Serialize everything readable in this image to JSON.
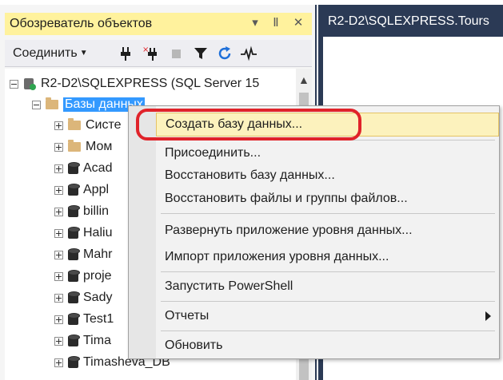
{
  "explorer": {
    "title": "Обозреватель объектов",
    "title_buttons": {
      "dropdown": "▾",
      "pin": "Ⅱ",
      "close": "✕"
    },
    "toolbar": {
      "connect_label": "Соединить"
    }
  },
  "tree": {
    "server": "R2-D2\\SQLEXPRESS (SQL Server 15",
    "databases_folder": "Базы данных",
    "items": [
      {
        "label": "Систе",
        "kind": "folder"
      },
      {
        "label": "Мом",
        "kind": "folder"
      },
      {
        "label": "Acad",
        "kind": "db"
      },
      {
        "label": "Appl",
        "kind": "db"
      },
      {
        "label": "billin",
        "kind": "db"
      },
      {
        "label": "Haliu",
        "kind": "db"
      },
      {
        "label": "Mahr",
        "kind": "db"
      },
      {
        "label": "proje",
        "kind": "db"
      },
      {
        "label": "Sady",
        "kind": "db"
      },
      {
        "label": "Test1",
        "kind": "db"
      },
      {
        "label": "Tima",
        "kind": "db"
      },
      {
        "label": "Timasheva_DB",
        "kind": "db"
      }
    ]
  },
  "document": {
    "tab_title": "R2-D2\\SQLEXPRESS.Tours"
  },
  "context_menu": {
    "items": [
      {
        "label": "Создать базу данных..."
      },
      {
        "label": "Присоединить..."
      },
      {
        "label": "Восстановить базу данных..."
      },
      {
        "label": "Восстановить файлы и группы файлов..."
      },
      {
        "label": "Развернуть приложение уровня данных..."
      },
      {
        "label": "Импорт приложения уровня данных..."
      },
      {
        "label": "Запустить PowerShell"
      },
      {
        "label": "Отчеты"
      },
      {
        "label": "Обновить"
      }
    ]
  },
  "colors": {
    "title_highlight": "#fff29d",
    "selection": "#3399ff",
    "menu_highlight": "#fcf2bd",
    "annotation_ring": "#e0232a",
    "dark_frame": "#2b3a55"
  }
}
